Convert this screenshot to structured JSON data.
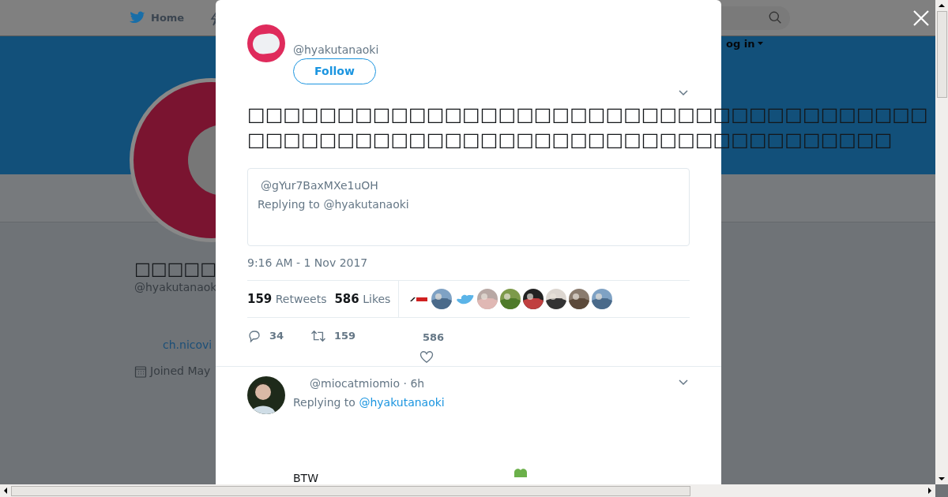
{
  "background_page": {
    "nav_home": "Home",
    "login": "og in",
    "profile_name": "□□□□□",
    "profile_handle": "@hyakutanaok",
    "profile_link": "ch.nicovi",
    "joined": "Joined May"
  },
  "tweet": {
    "handle": "@hyakutanaoki",
    "follow_label": "Follow",
    "text": "□□□□□□□□□□□□□□□□□□□□□□□□□□□□□□□□□□□□□□□□□□□□□□□□□□□□□□□□□□□□□□□□□□□□□□□□□□",
    "quote": {
      "handle": "@gYur7BaxMXe1uOH",
      "replying": "Replying to @hyakutanaoki"
    },
    "timestamp": "9:16 AM - 1 Nov 2017",
    "stats": [
      {
        "count": "159",
        "label": "Retweets"
      },
      {
        "count": "586",
        "label": "Likes"
      }
    ],
    "liker_avatars": [
      {
        "kind": "logo"
      },
      {
        "kind": "picture"
      },
      {
        "kind": "bird"
      },
      {
        "kind": "picture"
      },
      {
        "kind": "picture"
      },
      {
        "kind": "picture"
      },
      {
        "kind": "picture"
      },
      {
        "kind": "picture"
      },
      {
        "kind": "picture"
      }
    ],
    "actions": [
      {
        "kind": "reply",
        "count": "34"
      },
      {
        "kind": "retweet",
        "count": "159"
      },
      {
        "kind": "like",
        "count": "586"
      }
    ]
  },
  "reply": {
    "handle": "@miocatmiomio · 6h",
    "replying_prefix": "Replying to",
    "replying_to": "@hyakutanaoki",
    "text": "BTW"
  }
}
